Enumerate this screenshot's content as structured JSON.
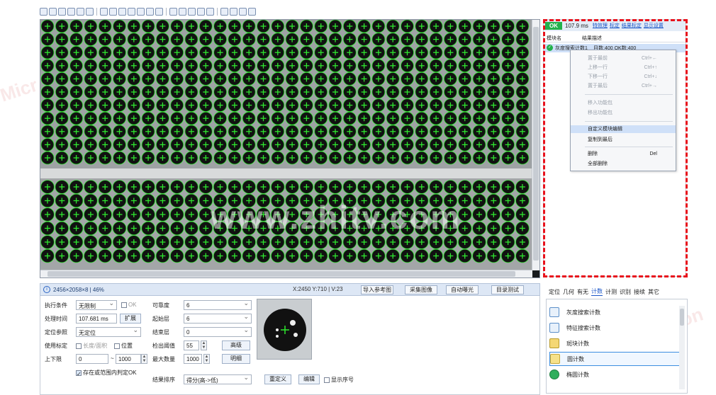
{
  "toolbar": {
    "icon_names": [
      "view-icon",
      "eye-icon",
      "add-icon",
      "play-icon",
      "circle-tool-icon",
      "record-icon",
      "crosshair-icon",
      "image-icon",
      "shield-icon",
      "settings-icon",
      "roi-icon",
      "layout-icon",
      "refresh-icon",
      "sync-icon",
      "calendar-icon",
      "chart-icon",
      "grid-icon",
      "box-icon",
      "gear-icon",
      "pin-icon",
      "gear2-icon",
      "info-icon"
    ]
  },
  "image": {
    "center_watermark": "www.zhitv.com"
  },
  "status": {
    "image_size": "2456×2058×8 | 46%",
    "cursor": "X:2450 Y:710 | V:23",
    "buttons": [
      "导入参考图",
      "采集图像",
      "自动曝光",
      "目录测试"
    ]
  },
  "params": {
    "left": [
      {
        "label": "执行条件",
        "value": "无限制"
      },
      {
        "label": "处理时间",
        "value": "107.681 ms"
      },
      {
        "label": "定位参照",
        "value": "无定位"
      },
      {
        "label": "使用标定",
        "value": ""
      },
      {
        "label": "上下限",
        "value": "0"
      }
    ],
    "ok_check": "OK",
    "expand_button": "扩展",
    "calib_options": [
      "长度/面积",
      "位置"
    ],
    "upper_limit": "1000",
    "range_check": "存在或范围内判定OK",
    "mid": [
      {
        "label": "可靠度",
        "value": "6"
      },
      {
        "label": "起始层",
        "value": "6"
      },
      {
        "label": "结束层",
        "value": "0"
      },
      {
        "label": "检出阈值",
        "value": "55"
      },
      {
        "label": "最大数量",
        "value": "1000"
      },
      {
        "label": "结果排序",
        "value": "得分(高->低)"
      }
    ],
    "advanced_button": "高级",
    "detail_button": "明细",
    "redefine_button": "重定义",
    "edit_button": "编辑",
    "show_index": "显示序号"
  },
  "results": {
    "ok": "OK",
    "elapsed": "107.9 ms",
    "links": [
      "特效理",
      "标定",
      "结果标定",
      "显示设置"
    ],
    "col_module": "模块名",
    "col_desc": "结果描述",
    "row_module": "灰度搜索计数1",
    "row_desc": "目数:400 OK数:400"
  },
  "context_menu": {
    "items": [
      {
        "label": "置于最前",
        "shortcut": "Ctrl+←",
        "disabled": true,
        "highlight": false
      },
      {
        "label": "上移一行",
        "shortcut": "Ctrl+↑",
        "disabled": true,
        "highlight": false
      },
      {
        "label": "下移一行",
        "shortcut": "Ctrl+↓",
        "disabled": true,
        "highlight": false
      },
      {
        "label": "置于最后",
        "shortcut": "Ctrl+→",
        "disabled": true,
        "highlight": false
      },
      {
        "label": "移入功能包",
        "shortcut": "",
        "disabled": true,
        "highlight": false
      },
      {
        "label": "移出功能包",
        "shortcut": "",
        "disabled": true,
        "highlight": false
      },
      {
        "label": "自定义模块编辑",
        "shortcut": "",
        "disabled": false,
        "highlight": true
      },
      {
        "label": "复制到最后",
        "shortcut": "",
        "disabled": false,
        "highlight": false
      },
      {
        "label": "删除",
        "shortcut": "Del",
        "disabled": false,
        "highlight": false
      },
      {
        "label": "全部删除",
        "shortcut": "",
        "disabled": false,
        "highlight": false
      }
    ]
  },
  "tools": {
    "tabs": [
      "定位",
      "几何",
      "有无",
      "计数",
      "计测",
      "识别",
      "接续",
      "其它"
    ],
    "active_tab": "计数",
    "items": [
      "灰度搜索计数",
      "特征搜索计数",
      "斑块计数",
      "圆计数",
      "椭圆计数"
    ],
    "selected": "圆计数"
  },
  "colors": {
    "ok_green": "#22b14c",
    "highlight_red": "#e8121c",
    "accent_blue": "#1a56c8",
    "detection_green": "#2ee82e"
  }
}
